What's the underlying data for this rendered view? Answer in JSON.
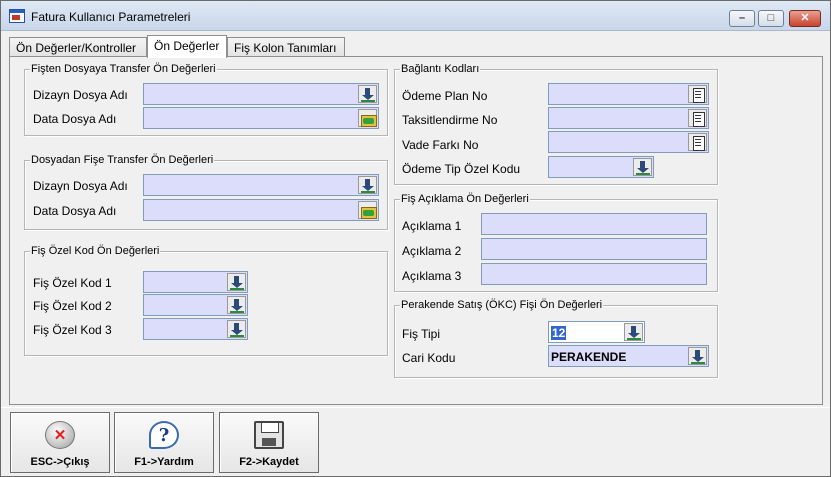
{
  "window": {
    "title": "Fatura Kullanıcı Parametreleri",
    "controls": {
      "minimize": "–",
      "maximize": "□",
      "close": "✕"
    }
  },
  "tabs": [
    {
      "label": "Ön Değerler/Kontroller",
      "active": false
    },
    {
      "label": "Ön Değerler",
      "active": true
    },
    {
      "label": "Fiş Kolon Tanımları",
      "active": false
    }
  ],
  "groups": {
    "fisten_dosyaya": {
      "title": "Fişten Dosyaya Transfer Ön Değerleri",
      "fields": [
        {
          "label": "Dizayn Dosya Adı",
          "value": "",
          "icon": "download-icon"
        },
        {
          "label": "Data Dosya Adı",
          "value": "",
          "icon": "folder-open-icon"
        }
      ]
    },
    "dosyadan_fise": {
      "title": "Dosyadan Fişe Transfer Ön Değerleri",
      "fields": [
        {
          "label": "Dizayn Dosya Adı",
          "value": "",
          "icon": "download-icon"
        },
        {
          "label": "Data Dosya Adı",
          "value": "",
          "icon": "folder-open-icon"
        }
      ]
    },
    "fis_ozel_kod": {
      "title": "Fiş Özel Kod Ön Değerleri",
      "fields": [
        {
          "label": "Fiş Özel Kod 1",
          "value": "",
          "icon": "download-icon"
        },
        {
          "label": "Fiş Özel Kod 2",
          "value": "",
          "icon": "download-icon"
        },
        {
          "label": "Fiş Özel Kod 3",
          "value": "",
          "icon": "download-icon"
        }
      ]
    },
    "baglanti_kodlari": {
      "title": "Bağlantı Kodları",
      "fields": [
        {
          "label": "Ödeme Plan No",
          "value": "",
          "icon": "calculator-icon"
        },
        {
          "label": "Taksitlendirme No",
          "value": "",
          "icon": "calculator-icon"
        },
        {
          "label": "Vade Farkı No",
          "value": "",
          "icon": "calculator-icon"
        },
        {
          "label": "Ödeme Tip Özel Kodu",
          "value": "",
          "icon": "download-icon"
        }
      ]
    },
    "fis_aciklama": {
      "title": "Fiş Açıklama Ön Değerleri",
      "fields": [
        {
          "label": "Açıklama 1",
          "value": ""
        },
        {
          "label": "Açıklama 2",
          "value": ""
        },
        {
          "label": "Açıklama 3",
          "value": ""
        }
      ]
    },
    "perakende": {
      "title": "Perakende Satış (ÖKC) Fişi Ön Değerleri",
      "fields": [
        {
          "label": "Fiş Tipi",
          "value": "12",
          "icon": "download-icon"
        },
        {
          "label": "Cari Kodu",
          "value": "PERAKENDE",
          "icon": "download-icon"
        }
      ]
    }
  },
  "footer": {
    "buttons": [
      {
        "label": "ESC->Çıkış",
        "icon": "exit-icon"
      },
      {
        "label": "F1->Yardım",
        "icon": "help-icon"
      },
      {
        "label": "F2->Kaydet",
        "icon": "save-icon"
      }
    ]
  }
}
